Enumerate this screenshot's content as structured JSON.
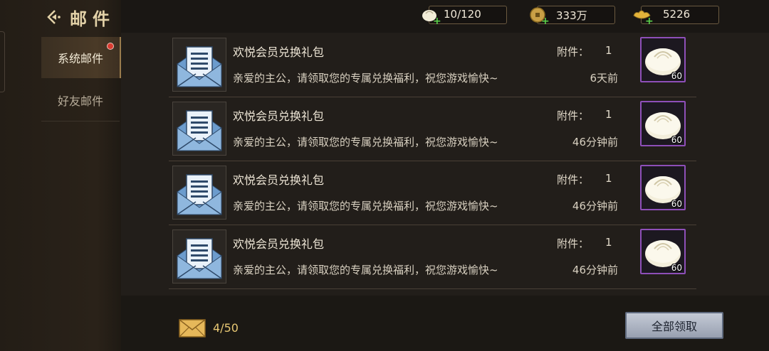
{
  "header": {
    "title": "邮件"
  },
  "tabs": [
    {
      "label": "系统邮件",
      "active": true,
      "has_badge": true
    },
    {
      "label": "好友邮件",
      "active": false,
      "has_badge": false
    }
  ],
  "resources": [
    {
      "icon": "bun-icon",
      "value": "10/120"
    },
    {
      "icon": "copper-coin-icon",
      "value": "333万"
    },
    {
      "icon": "gold-ingot-icon",
      "value": "5226"
    }
  ],
  "mails": [
    {
      "subject": "欢悦会员兑换礼包",
      "body": "亲爱的主公，请领取您的专属兑换福利，祝您游戏愉快~",
      "attachment_label": "附件：",
      "attachment_count": "1",
      "time": "6天前",
      "item": {
        "icon": "steamed-bun-icon",
        "quantity": "60"
      }
    },
    {
      "subject": "欢悦会员兑换礼包",
      "body": "亲爱的主公，请领取您的专属兑换福利，祝您游戏愉快~",
      "attachment_label": "附件：",
      "attachment_count": "1",
      "time": "46分钟前",
      "item": {
        "icon": "steamed-bun-icon",
        "quantity": "60"
      }
    },
    {
      "subject": "欢悦会员兑换礼包",
      "body": "亲爱的主公，请领取您的专属兑换福利，祝您游戏愉快~",
      "attachment_label": "附件：",
      "attachment_count": "1",
      "time": "46分钟前",
      "item": {
        "icon": "steamed-bun-icon",
        "quantity": "60"
      }
    },
    {
      "subject": "欢悦会员兑换礼包",
      "body": "亲爱的主公，请领取您的专属兑换福利，祝您游戏愉快~",
      "attachment_label": "附件：",
      "attachment_count": "1",
      "time": "46分钟前",
      "item": {
        "icon": "steamed-bun-icon",
        "quantity": "60"
      }
    }
  ],
  "footer": {
    "mail_count": "4/50",
    "claim_all_label": "全部领取"
  },
  "colors": {
    "item_border": "#8e4fb8",
    "accent_gold": "#e8c874",
    "badge_red": "#d93b30"
  }
}
